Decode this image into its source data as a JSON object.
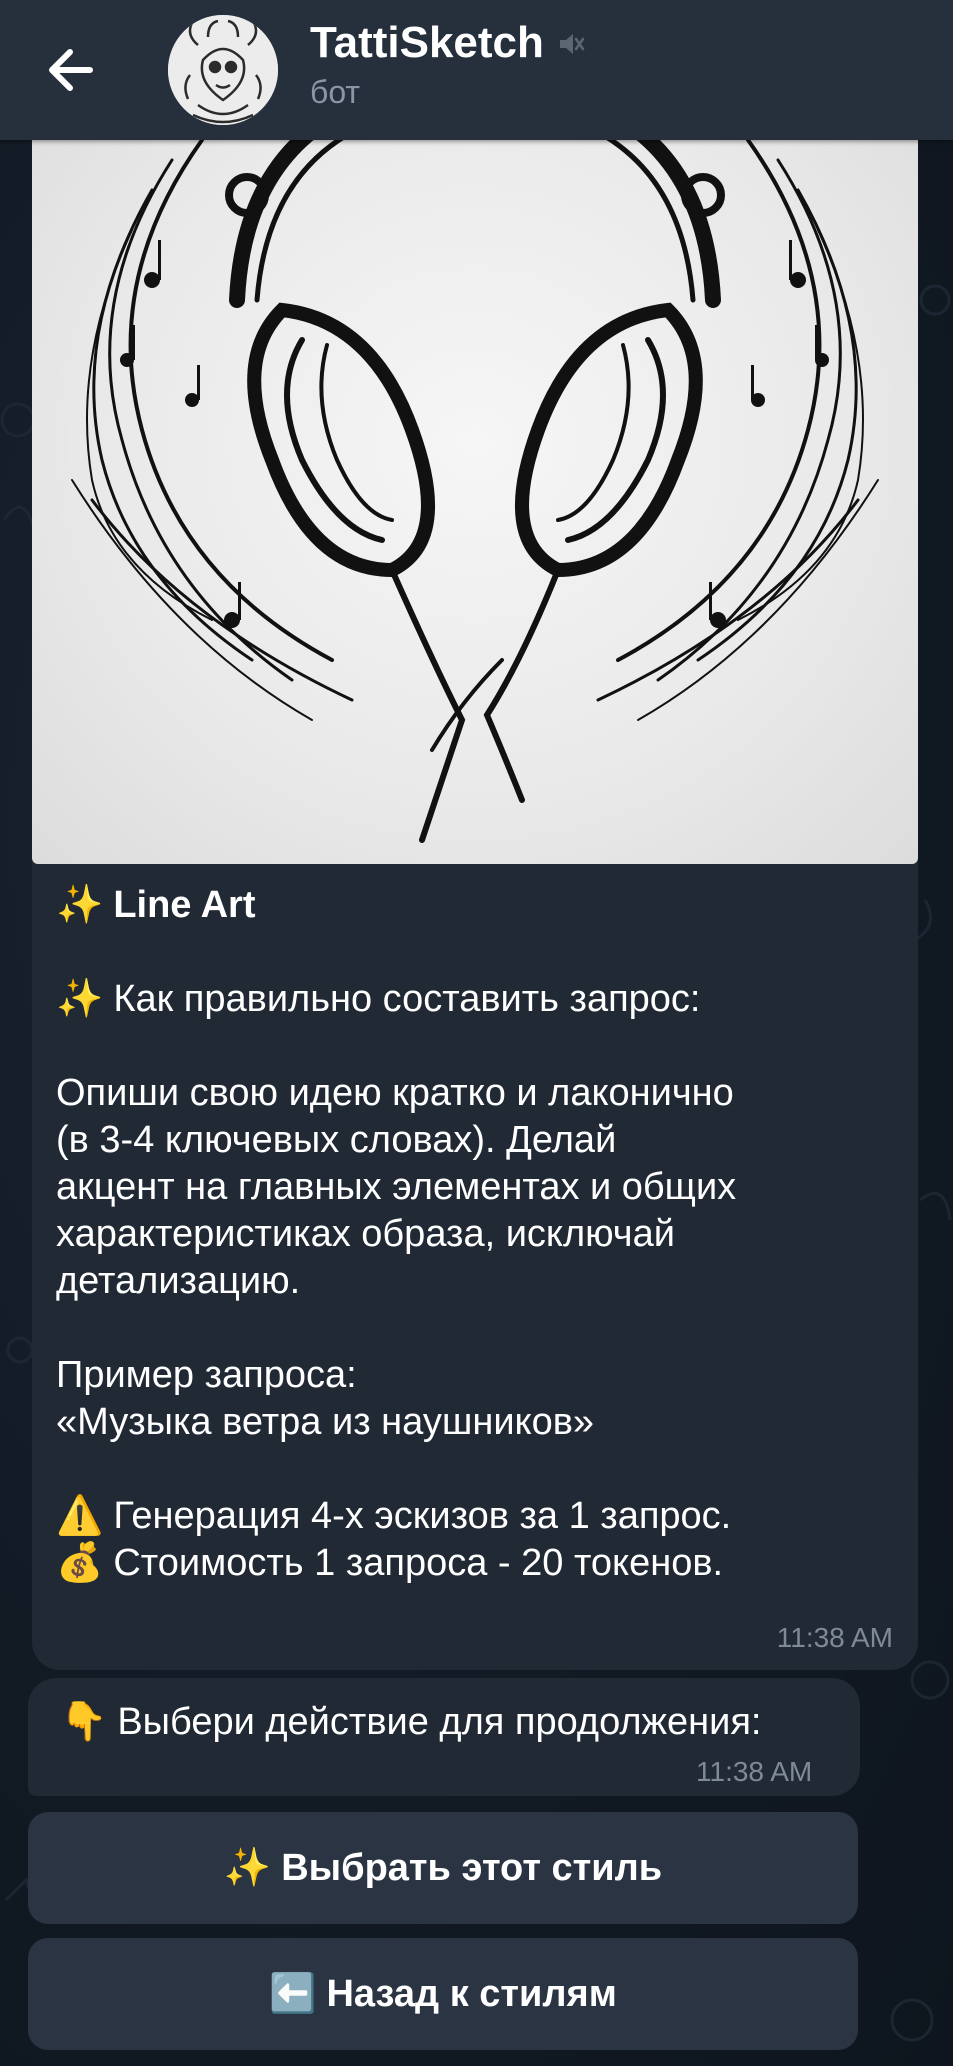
{
  "header": {
    "title": "TattiSketch",
    "subtitle": "бот",
    "icons": {
      "back": "arrow-left-icon",
      "mute": "speaker-muted-icon",
      "avatar": "bot-avatar"
    }
  },
  "message1": {
    "style_title": "Line Art",
    "how_to_title": "Как правильно составить запрос:",
    "description_lines": [
      "Опиши свою идею кратко и лаконично",
      "(в 3-4 ключевых словах). Делай",
      "акцент на главных элементах и общих",
      "характеристиках образа, исключай",
      "детализацию."
    ],
    "example_label": "Пример запроса:",
    "example_value": "«Музыка ветра из наушников»",
    "generation_note": "Генерация 4-х эскизов за 1 запрос.",
    "cost_note": "Стоимость 1 запроса - 20 токенов.",
    "time": "11:38 AM"
  },
  "message2": {
    "text": "Выбери действие для продолжения:",
    "time": "11:38 AM"
  },
  "buttons": {
    "select_style": "Выбрать этот стиль",
    "back_to_styles": "Назад к стилям"
  },
  "colors": {
    "header_bg": "#26303d",
    "bubble_bg": "#212935",
    "button_bg": "#2a3442",
    "time_text": "#7f8a97",
    "subtitle_text": "#8a96a3"
  }
}
